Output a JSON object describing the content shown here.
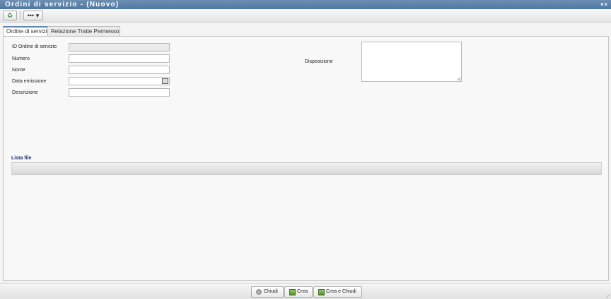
{
  "window": {
    "title": "Ordini di servizio - (Nuovo)",
    "controls": "▾✕"
  },
  "toolbar": {
    "refresh_glyph": "♻",
    "more_glyph": "•••  ▾"
  },
  "tabs": [
    {
      "label": "Ordine di servizio",
      "active": true
    },
    {
      "label": "Relazione Tratte Permesso",
      "active": false
    }
  ],
  "form": {
    "id_label": "ID Ordine di servizio",
    "id_value": "",
    "numero_label": "Numero",
    "numero_value": "",
    "nome_label": "Nome",
    "nome_value": "",
    "data_label": "Data emissione",
    "data_value": "",
    "descrizione_label": "Descrizione",
    "descrizione_value": "",
    "disposizione_label": "Disposizione",
    "disposizione_value": ""
  },
  "files": {
    "title": "Lista file"
  },
  "footer": {
    "close_label": "Chiudi",
    "create_label": "Crea",
    "create_close_label": "Crea e Chiudi"
  },
  "icons": [
    "refresh-icon",
    "more-icon",
    "calendar-icon",
    "close-icon",
    "create-icon",
    "create-close-icon"
  ]
}
